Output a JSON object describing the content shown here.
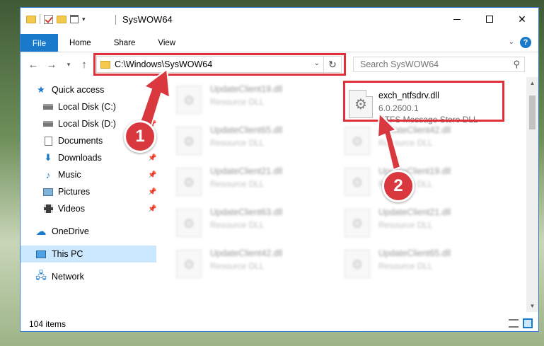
{
  "window": {
    "title": "SysWOW64",
    "minimize_label": "",
    "close_label": "✕"
  },
  "ribbon": {
    "tabs": [
      "File",
      "Home",
      "Share",
      "View"
    ],
    "help": "?"
  },
  "address_bar": {
    "path": "C:\\Windows\\SysWOW64"
  },
  "search": {
    "placeholder": "Search SysWOW64"
  },
  "sidebar": {
    "items": [
      {
        "label": "Quick access",
        "icon": "star-icon"
      },
      {
        "label": "Local Disk (C:)",
        "icon": "drive-icon"
      },
      {
        "label": "Local Disk (D:)",
        "icon": "drive-icon"
      },
      {
        "label": "Documents",
        "icon": "documents-icon"
      },
      {
        "label": "Downloads",
        "icon": "download-icon"
      },
      {
        "label": "Music",
        "icon": "music-icon"
      },
      {
        "label": "Pictures",
        "icon": "pictures-icon"
      },
      {
        "label": "Videos",
        "icon": "videos-icon"
      },
      {
        "label": "OneDrive",
        "icon": "cloud-icon"
      },
      {
        "label": "This PC",
        "icon": "computer-icon"
      },
      {
        "label": "Network",
        "icon": "network-icon"
      }
    ]
  },
  "files": {
    "blurred": [
      {
        "name": "UpdateClient19.dll",
        "desc": "Resource DLL"
      },
      {
        "name": "UpdateClient65.dll",
        "desc": "Resource DLL"
      },
      {
        "name": "UpdateClient42.dll",
        "desc": "Resource DLL"
      },
      {
        "name": "UpdateClient21.dll",
        "desc": "Resource DLL"
      },
      {
        "name": "UpdateClient19.dll",
        "desc": "Resource DLL"
      },
      {
        "name": "UpdateClient63.dll",
        "desc": "Resource DLL"
      },
      {
        "name": "UpdateClient21.dll",
        "desc": "Resource DLL"
      },
      {
        "name": "UpdateClient42.dll",
        "desc": "Resource DLL"
      },
      {
        "name": "UpdateClient65.dll",
        "desc": "Resource DLL"
      }
    ],
    "target": {
      "name": "exch_ntfsdrv.dll",
      "version": "6.0.2600.1",
      "desc": "NTFS Message Store DLL"
    }
  },
  "status": {
    "item_count": "104 items"
  },
  "callouts": {
    "one": "1",
    "two": "2"
  },
  "colors": {
    "accent": "#1979ca",
    "highlight": "#e0303a",
    "selection": "#cce8ff"
  }
}
